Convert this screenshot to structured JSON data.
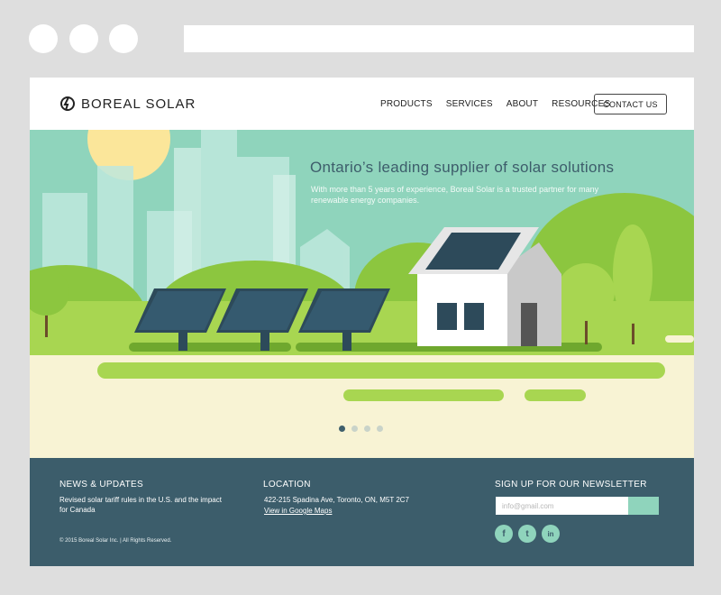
{
  "browser": {
    "url": ""
  },
  "header": {
    "logo_text": "BOREAL SOLAR",
    "nav": [
      "PRODUCTS",
      "SERVICES",
      "ABOUT",
      "RESOURCES"
    ],
    "contact_label": "CONTACT US"
  },
  "hero": {
    "title": "Ontario’s leading supplier of solar solutions",
    "subtitle": "With more than 5 years of experience, Boreal Solar is a trusted partner for many renewable energy companies.",
    "slide_count": 4,
    "active_slide": 1
  },
  "footer": {
    "news_heading": "NEWS & UPDATES",
    "news_text": "Revised solar tariff rules in the U.S. and the impact for Canada",
    "location_heading": "LOCATION",
    "address": "422-215 Spadina Ave, Toronto, ON, M5T 2C7",
    "map_link": "View in Google Maps",
    "newsletter_heading": "SIGN UP FOR OUR NEWSLETTER",
    "email_placeholder": "info@gmail.com",
    "social": [
      {
        "icon": "facebook-icon",
        "glyph": "f"
      },
      {
        "icon": "twitter-icon",
        "glyph": "t"
      },
      {
        "icon": "linkedin-icon",
        "glyph": "in"
      }
    ],
    "copyright": "© 2015 Boreal Solar Inc. | All Rights Reserved."
  },
  "colors": {
    "accent": "#8fd4bc",
    "footer_bg": "#3c5d6b",
    "title": "#3d5d6b",
    "grass": "#8cc63f"
  }
}
